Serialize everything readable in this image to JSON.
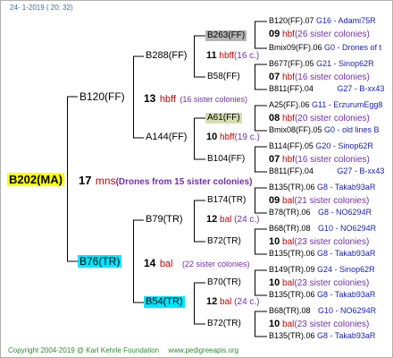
{
  "header": {
    "date": "24-  1-2019  ( 20:  32)"
  },
  "queens": {
    "root": "B202(MA)",
    "father": "B120(FF)",
    "mother": "B76(TR)",
    "ff": "B288(FF)",
    "fm": "A144(FF)",
    "mf": "B79(TR)",
    "mm": "B54(TR)",
    "fff": "B263(FF)",
    "ffm": "B58(FF)",
    "fmf": "A61(FF)",
    "fmm": "B104(FF)",
    "mff": "B174(TR)",
    "mfm": "B72(TR)",
    "mmf": "B70(TR)",
    "mmm": "B72(TR)"
  },
  "matings": {
    "root": {
      "num": "17",
      "code": "mns",
      "note": "(Drones from 15 sister colonies)"
    },
    "father": {
      "num": "13",
      "code": "hbff",
      "note": "(16 sister colonies)"
    },
    "mother": {
      "num": "14",
      "code": "bal",
      "note": "(22 sister colonies)"
    },
    "ff": {
      "num": "11",
      "code": "hbff",
      "note": "(16 c.)"
    },
    "fm": {
      "num": "10",
      "code": "hbff",
      "note": "(19 c.)"
    },
    "mf": {
      "num": "12",
      "code": "bal",
      "note": "(24 c.)"
    },
    "mm": {
      "num": "12",
      "code": "bal",
      "note": "(24 c.)"
    }
  },
  "leaves": [
    {
      "parent": "B120(FF).07",
      "id": "G16 - Adami75R"
    },
    {
      "num": "09",
      "code": "hbf",
      "note": "(26 sister colonies)"
    },
    {
      "parent": "Bmix09(FF).06",
      "id": "G0 - Drones of t"
    },
    {
      "parent": "B677(FF).05",
      "id": "G21 - Sinop62R"
    },
    {
      "num": "07",
      "code": "hbf",
      "note": "(16 sister colonies)"
    },
    {
      "parent": "B811(FF).04",
      "id": "G27 - B-xx43"
    },
    {
      "parent": "A25(FF).06",
      "id": "G11 - ErzurumEgg8"
    },
    {
      "num": "08",
      "code": "hbf",
      "note": "(20 sister colonies)"
    },
    {
      "parent": "Bmix08(FF).05",
      "id": "G0 - old lines B"
    },
    {
      "parent": "B114(FF).05",
      "id": "G20 - Sinop62R"
    },
    {
      "num": "07",
      "code": "hbf",
      "note": "(16 sister colonies)"
    },
    {
      "parent": "B811(FF).04",
      "id": "G27 - B-xx43"
    },
    {
      "parent": "B135(TR).06",
      "id": "G8 - Takab93aR"
    },
    {
      "num": "09",
      "code": "bal",
      "note": "(21 sister colonies)"
    },
    {
      "parent": "B78(TR).06",
      "id": "G8 - NO6294R"
    },
    {
      "parent": "B68(TR).08",
      "id": "G10 - NO6294R"
    },
    {
      "num": "10",
      "code": "bal",
      "note": "(23 sister colonies)"
    },
    {
      "parent": "B135(TR).06",
      "id": "G8 - Takab93aR"
    },
    {
      "parent": "B149(TR).09",
      "id": "G24 - Sinop62R"
    },
    {
      "num": "10",
      "code": "bal",
      "note": "(23 sister colonies)"
    },
    {
      "parent": "B135(TR).06",
      "id": "G8 - Takab93aR"
    },
    {
      "parent": "B68(TR).08",
      "id": "G10 - NO6294R"
    },
    {
      "num": "10",
      "code": "bal",
      "note": "(23 sister colonies)"
    },
    {
      "parent": "B135(TR).06",
      "id": "G8 - Takab93aR"
    }
  ],
  "footer": {
    "copyright": "Copyright 2004-2019 @ Karl Kehrle Foundation",
    "site": "www.pedigreeapis.org"
  },
  "colors": {
    "lines": "#000000",
    "yellow": "#ffff00",
    "cyan": "#00e5ff",
    "gray": "#b5b5b5",
    "mating_code": "#c00000",
    "mating_note": "#7030a0",
    "leaf_id": "#1a22aa",
    "footer": "#2e8b2e",
    "header": "#3c6e9e"
  }
}
